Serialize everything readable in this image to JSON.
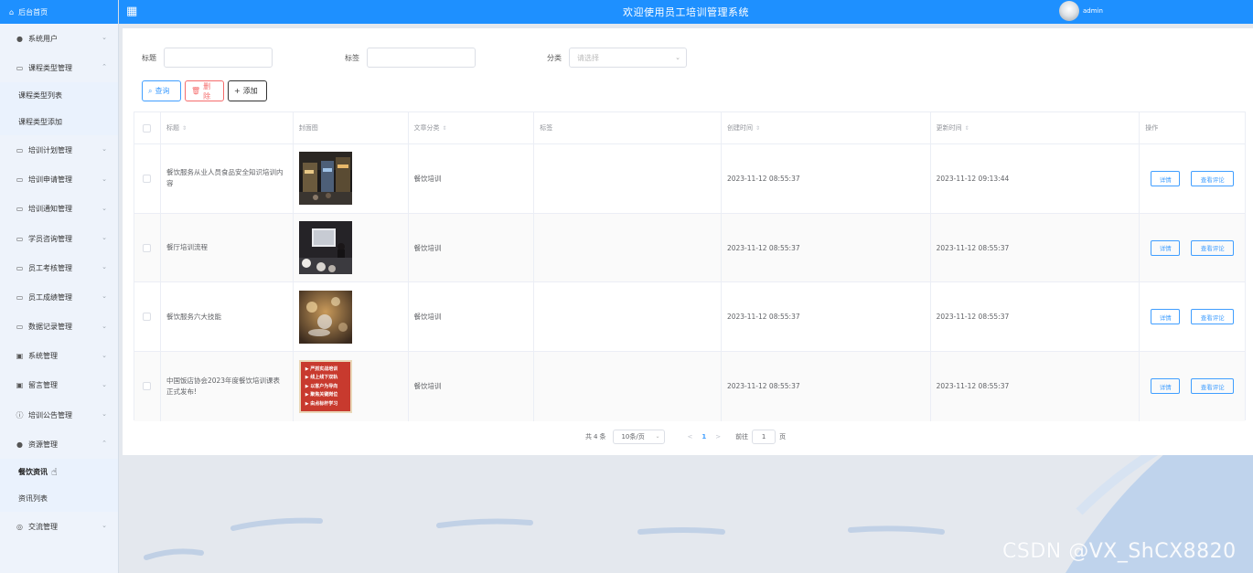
{
  "topbar": {
    "system_title": "欢迎使用员工培训管理系统",
    "username": "admin"
  },
  "sidebar": {
    "home_label": "后台首页",
    "items": [
      {
        "label": "系统用户",
        "icon": "user-icon"
      },
      {
        "label": "课程类型管理",
        "icon": "folder-icon",
        "expanded": true,
        "children": [
          {
            "label": "课程类型列表"
          },
          {
            "label": "课程类型添加"
          }
        ]
      },
      {
        "label": "培训计划管理",
        "icon": "folder-icon"
      },
      {
        "label": "培训申请管理",
        "icon": "folder-icon"
      },
      {
        "label": "培训通知管理",
        "icon": "folder-icon"
      },
      {
        "label": "学员咨询管理",
        "icon": "folder-icon"
      },
      {
        "label": "员工考核管理",
        "icon": "folder-icon"
      },
      {
        "label": "员工成绩管理",
        "icon": "folder-icon"
      },
      {
        "label": "数据记录管理",
        "icon": "folder-icon"
      },
      {
        "label": "系统管理",
        "icon": "image-icon"
      },
      {
        "label": "留言管理",
        "icon": "image-icon"
      },
      {
        "label": "培训公告管理",
        "icon": "info-icon"
      },
      {
        "label": "资源管理",
        "icon": "location-icon",
        "expanded": true,
        "children": [
          {
            "label": "餐饮资讯",
            "active": true
          },
          {
            "label": "资讯列表"
          }
        ]
      },
      {
        "label": "交流管理",
        "icon": "chat-icon"
      }
    ]
  },
  "search": {
    "title_label": "标题",
    "title_value": "",
    "tag_label": "标签",
    "tag_value": "",
    "category_label": "分类",
    "category_placeholder": "请选择"
  },
  "buttons": {
    "query": "查询",
    "delete": "删除",
    "add": "添加"
  },
  "table": {
    "headers": {
      "title": "标题",
      "cover": "封面图",
      "category": "文章分类",
      "tags": "标签",
      "created": "创建时间",
      "updated": "更新时间",
      "actions": "操作"
    },
    "rows": [
      {
        "title": "餐饮服务从业人员食品安全知识培训内容",
        "category": "餐饮培训",
        "tags": "",
        "created": "2023-11-12 08:55:37",
        "updated": "2023-11-12 09:13:44",
        "cover": "street-photo"
      },
      {
        "title": "餐厅培训流程",
        "category": "餐饮培训",
        "tags": "",
        "created": "2023-11-12 08:55:37",
        "updated": "2023-11-12 08:55:37",
        "cover": "classroom-photo"
      },
      {
        "title": "餐饮服务六大技能",
        "category": "餐饮培训",
        "tags": "",
        "created": "2023-11-12 08:55:37",
        "updated": "2023-11-12 08:55:37",
        "cover": "dining-photo"
      },
      {
        "title": "中国饭店协会2023年度餐饮培训课表正式发布!",
        "category": "餐饮培训",
        "tags": "",
        "created": "2023-11-12 08:55:37",
        "updated": "2023-11-12 08:55:37",
        "cover": "red-banner",
        "banner_lines": [
          "严抓实战培训",
          "线上线下双轨",
          "以客户为导向",
          "聚焦关键岗位",
          "由点标杆学习"
        ]
      }
    ],
    "detail_label": "详情",
    "review_label": "查看评论"
  },
  "pagination": {
    "total_prefix": "共",
    "total": "4",
    "total_suffix": "条",
    "page_size": "10条/页",
    "prev": "<",
    "current_page": "1",
    "next": ">",
    "goto_label": "前往",
    "goto_value": "1",
    "page_suffix": "页"
  },
  "watermark": "CSDN @VX_ShCX8820",
  "colors": {
    "primary": "#1e90ff",
    "link": "#409eff",
    "danger": "#f56c6c"
  }
}
